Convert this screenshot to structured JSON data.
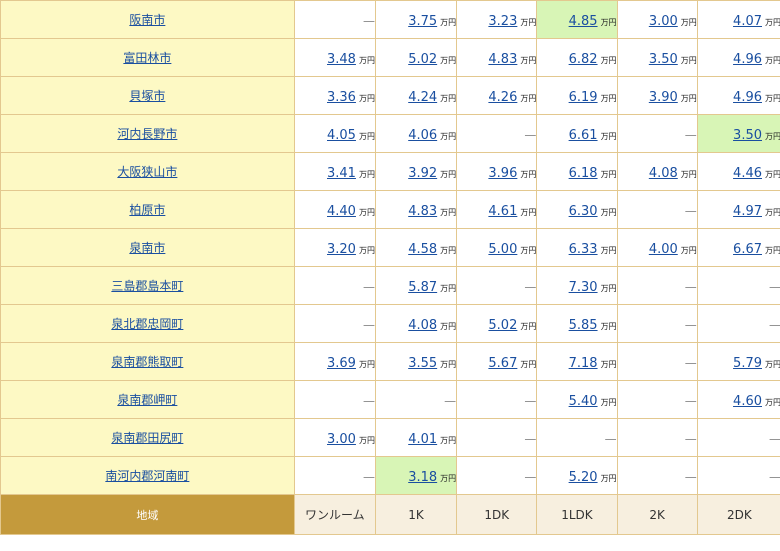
{
  "footer": {
    "area_label": "地域",
    "columns": [
      "ワンルーム",
      "1K",
      "1DK",
      "1LDK",
      "2K",
      "2DK"
    ]
  },
  "unit": "万円",
  "dash": "—",
  "colors": {
    "area_bg": "#fdf9c4",
    "highlight_bg": "#d8f5b6",
    "header_gold": "#c49a3c",
    "link": "#1a4fa0",
    "border": "#e3c88f"
  },
  "rows": [
    {
      "area": "阪南市",
      "values": [
        "—",
        "3.75",
        "3.23",
        "4.85",
        "3.00",
        "4.07"
      ],
      "highlight": [
        false,
        false,
        false,
        true,
        false,
        false
      ]
    },
    {
      "area": "富田林市",
      "values": [
        "3.48",
        "5.02",
        "4.83",
        "6.82",
        "3.50",
        "4.96"
      ],
      "highlight": [
        false,
        false,
        false,
        false,
        false,
        false
      ]
    },
    {
      "area": "貝塚市",
      "values": [
        "3.36",
        "4.24",
        "4.26",
        "6.19",
        "3.90",
        "4.96"
      ],
      "highlight": [
        false,
        false,
        false,
        false,
        false,
        false
      ]
    },
    {
      "area": "河内長野市",
      "values": [
        "4.05",
        "4.06",
        "—",
        "6.61",
        "—",
        "3.50"
      ],
      "highlight": [
        false,
        false,
        false,
        false,
        false,
        true
      ]
    },
    {
      "area": "大阪狭山市",
      "values": [
        "3.41",
        "3.92",
        "3.96",
        "6.18",
        "4.08",
        "4.46"
      ],
      "highlight": [
        false,
        false,
        false,
        false,
        false,
        false
      ]
    },
    {
      "area": "柏原市",
      "values": [
        "4.40",
        "4.83",
        "4.61",
        "6.30",
        "—",
        "4.97"
      ],
      "highlight": [
        false,
        false,
        false,
        false,
        false,
        false
      ]
    },
    {
      "area": "泉南市",
      "values": [
        "3.20",
        "4.58",
        "5.00",
        "6.33",
        "4.00",
        "6.67"
      ],
      "highlight": [
        false,
        false,
        false,
        false,
        false,
        false
      ]
    },
    {
      "area": "三島郡島本町",
      "values": [
        "—",
        "5.87",
        "—",
        "7.30",
        "—",
        "—"
      ],
      "highlight": [
        false,
        false,
        false,
        false,
        false,
        false
      ]
    },
    {
      "area": "泉北郡忠岡町",
      "values": [
        "—",
        "4.08",
        "5.02",
        "5.85",
        "—",
        "—"
      ],
      "highlight": [
        false,
        false,
        false,
        false,
        false,
        false
      ]
    },
    {
      "area": "泉南郡熊取町",
      "values": [
        "3.69",
        "3.55",
        "5.67",
        "7.18",
        "—",
        "5.79"
      ],
      "highlight": [
        false,
        false,
        false,
        false,
        false,
        false
      ]
    },
    {
      "area": "泉南郡岬町",
      "values": [
        "—",
        "—",
        "—",
        "5.40",
        "—",
        "4.60"
      ],
      "highlight": [
        false,
        false,
        false,
        false,
        false,
        false
      ]
    },
    {
      "area": "泉南郡田尻町",
      "values": [
        "3.00",
        "4.01",
        "—",
        "—",
        "—",
        "—"
      ],
      "highlight": [
        false,
        false,
        false,
        false,
        false,
        false
      ]
    },
    {
      "area": "南河内郡河南町",
      "values": [
        "—",
        "3.18",
        "—",
        "5.20",
        "—",
        "—"
      ],
      "highlight": [
        false,
        true,
        false,
        false,
        false,
        false
      ]
    }
  ]
}
